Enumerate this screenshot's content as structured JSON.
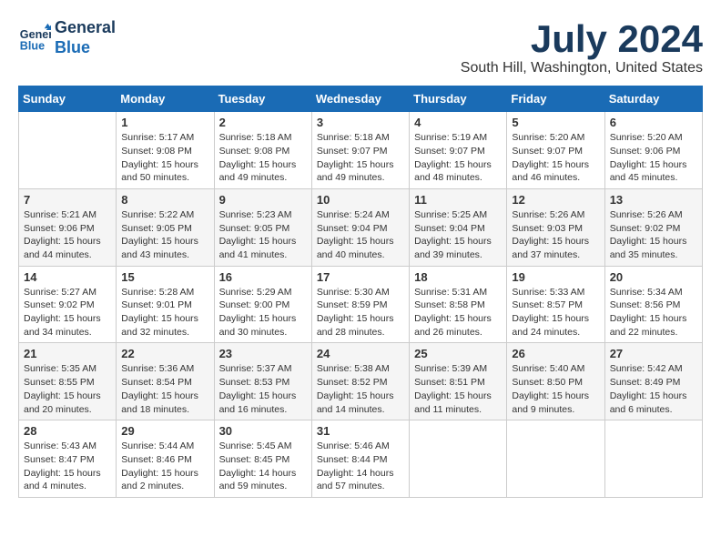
{
  "header": {
    "logo_line1": "General",
    "logo_line2": "Blue",
    "month": "July 2024",
    "location": "South Hill, Washington, United States"
  },
  "weekdays": [
    "Sunday",
    "Monday",
    "Tuesday",
    "Wednesday",
    "Thursday",
    "Friday",
    "Saturday"
  ],
  "weeks": [
    [
      {
        "day": "",
        "info": ""
      },
      {
        "day": "1",
        "info": "Sunrise: 5:17 AM\nSunset: 9:08 PM\nDaylight: 15 hours\nand 50 minutes."
      },
      {
        "day": "2",
        "info": "Sunrise: 5:18 AM\nSunset: 9:08 PM\nDaylight: 15 hours\nand 49 minutes."
      },
      {
        "day": "3",
        "info": "Sunrise: 5:18 AM\nSunset: 9:07 PM\nDaylight: 15 hours\nand 49 minutes."
      },
      {
        "day": "4",
        "info": "Sunrise: 5:19 AM\nSunset: 9:07 PM\nDaylight: 15 hours\nand 48 minutes."
      },
      {
        "day": "5",
        "info": "Sunrise: 5:20 AM\nSunset: 9:07 PM\nDaylight: 15 hours\nand 46 minutes."
      },
      {
        "day": "6",
        "info": "Sunrise: 5:20 AM\nSunset: 9:06 PM\nDaylight: 15 hours\nand 45 minutes."
      }
    ],
    [
      {
        "day": "7",
        "info": "Sunrise: 5:21 AM\nSunset: 9:06 PM\nDaylight: 15 hours\nand 44 minutes."
      },
      {
        "day": "8",
        "info": "Sunrise: 5:22 AM\nSunset: 9:05 PM\nDaylight: 15 hours\nand 43 minutes."
      },
      {
        "day": "9",
        "info": "Sunrise: 5:23 AM\nSunset: 9:05 PM\nDaylight: 15 hours\nand 41 minutes."
      },
      {
        "day": "10",
        "info": "Sunrise: 5:24 AM\nSunset: 9:04 PM\nDaylight: 15 hours\nand 40 minutes."
      },
      {
        "day": "11",
        "info": "Sunrise: 5:25 AM\nSunset: 9:04 PM\nDaylight: 15 hours\nand 39 minutes."
      },
      {
        "day": "12",
        "info": "Sunrise: 5:26 AM\nSunset: 9:03 PM\nDaylight: 15 hours\nand 37 minutes."
      },
      {
        "day": "13",
        "info": "Sunrise: 5:26 AM\nSunset: 9:02 PM\nDaylight: 15 hours\nand 35 minutes."
      }
    ],
    [
      {
        "day": "14",
        "info": "Sunrise: 5:27 AM\nSunset: 9:02 PM\nDaylight: 15 hours\nand 34 minutes."
      },
      {
        "day": "15",
        "info": "Sunrise: 5:28 AM\nSunset: 9:01 PM\nDaylight: 15 hours\nand 32 minutes."
      },
      {
        "day": "16",
        "info": "Sunrise: 5:29 AM\nSunset: 9:00 PM\nDaylight: 15 hours\nand 30 minutes."
      },
      {
        "day": "17",
        "info": "Sunrise: 5:30 AM\nSunset: 8:59 PM\nDaylight: 15 hours\nand 28 minutes."
      },
      {
        "day": "18",
        "info": "Sunrise: 5:31 AM\nSunset: 8:58 PM\nDaylight: 15 hours\nand 26 minutes."
      },
      {
        "day": "19",
        "info": "Sunrise: 5:33 AM\nSunset: 8:57 PM\nDaylight: 15 hours\nand 24 minutes."
      },
      {
        "day": "20",
        "info": "Sunrise: 5:34 AM\nSunset: 8:56 PM\nDaylight: 15 hours\nand 22 minutes."
      }
    ],
    [
      {
        "day": "21",
        "info": "Sunrise: 5:35 AM\nSunset: 8:55 PM\nDaylight: 15 hours\nand 20 minutes."
      },
      {
        "day": "22",
        "info": "Sunrise: 5:36 AM\nSunset: 8:54 PM\nDaylight: 15 hours\nand 18 minutes."
      },
      {
        "day": "23",
        "info": "Sunrise: 5:37 AM\nSunset: 8:53 PM\nDaylight: 15 hours\nand 16 minutes."
      },
      {
        "day": "24",
        "info": "Sunrise: 5:38 AM\nSunset: 8:52 PM\nDaylight: 15 hours\nand 14 minutes."
      },
      {
        "day": "25",
        "info": "Sunrise: 5:39 AM\nSunset: 8:51 PM\nDaylight: 15 hours\nand 11 minutes."
      },
      {
        "day": "26",
        "info": "Sunrise: 5:40 AM\nSunset: 8:50 PM\nDaylight: 15 hours\nand 9 minutes."
      },
      {
        "day": "27",
        "info": "Sunrise: 5:42 AM\nSunset: 8:49 PM\nDaylight: 15 hours\nand 6 minutes."
      }
    ],
    [
      {
        "day": "28",
        "info": "Sunrise: 5:43 AM\nSunset: 8:47 PM\nDaylight: 15 hours\nand 4 minutes."
      },
      {
        "day": "29",
        "info": "Sunrise: 5:44 AM\nSunset: 8:46 PM\nDaylight: 15 hours\nand 2 minutes."
      },
      {
        "day": "30",
        "info": "Sunrise: 5:45 AM\nSunset: 8:45 PM\nDaylight: 14 hours\nand 59 minutes."
      },
      {
        "day": "31",
        "info": "Sunrise: 5:46 AM\nSunset: 8:44 PM\nDaylight: 14 hours\nand 57 minutes."
      },
      {
        "day": "",
        "info": ""
      },
      {
        "day": "",
        "info": ""
      },
      {
        "day": "",
        "info": ""
      }
    ]
  ]
}
